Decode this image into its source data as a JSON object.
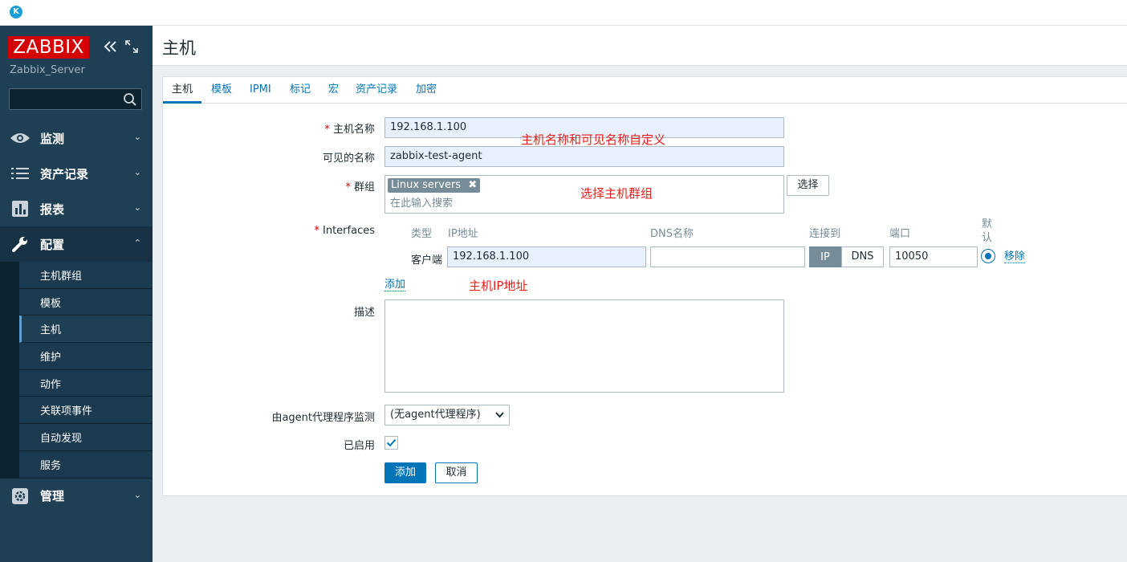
{
  "topbar": {
    "app_icon_letter": "K"
  },
  "sidebar": {
    "logo": "ZABBIX",
    "server_name": "Zabbix_Server",
    "search_value": "",
    "menu": [
      {
        "label": "监测",
        "icon": "eye-icon"
      },
      {
        "label": "资产记录",
        "icon": "list-icon"
      },
      {
        "label": "报表",
        "icon": "bar-chart-icon"
      },
      {
        "label": "配置",
        "icon": "wrench-icon"
      },
      {
        "label": "管理",
        "icon": "gear-icon"
      }
    ],
    "submenu": [
      "主机群组",
      "模板",
      "主机",
      "维护",
      "动作",
      "关联项事件",
      "自动发现",
      "服务"
    ],
    "active_submenu": "主机"
  },
  "header": {
    "title": "主机"
  },
  "tabs": [
    "主机",
    "模板",
    "IPMI",
    "标记",
    "宏",
    "资产记录",
    "加密"
  ],
  "form": {
    "hostname_label": "主机名称",
    "hostname_value": "192.168.1.100",
    "visible_name_label": "可见的名称",
    "visible_name_value": "zabbix-test-agent",
    "groups_label": "群组",
    "group_tag": "Linux servers",
    "group_placeholder": "在此输入搜索",
    "select_button": "选择",
    "interfaces_label": "Interfaces",
    "interface_columns": {
      "type": "类型",
      "ip": "IP地址",
      "dns": "DNS名称",
      "connect": "连接到",
      "port": "端口",
      "default_line1": "默",
      "default_line2": "认"
    },
    "interface_row": {
      "type": "客户端",
      "ip": "192.168.1.100",
      "dns": "",
      "connect_ip": "IP",
      "connect_dns": "DNS",
      "port": "10050",
      "remove": "移除"
    },
    "add_interface_link": "添加",
    "description_label": "描述",
    "description_value": "",
    "proxy_label": "由agent代理程序监测",
    "proxy_value": "(无agent代理程序)",
    "enabled_label": "已启用",
    "enabled": true,
    "add_button": "添加",
    "cancel_button": "取消"
  },
  "annotations": {
    "names": "主机名称和可见名称自定义",
    "group": "选择主机群组",
    "ip": "主机IP地址"
  },
  "colors": {
    "accent": "#0275b8",
    "sidebar": "#1f3f55",
    "logo": "#d40000",
    "annotation": "#e5201c"
  }
}
